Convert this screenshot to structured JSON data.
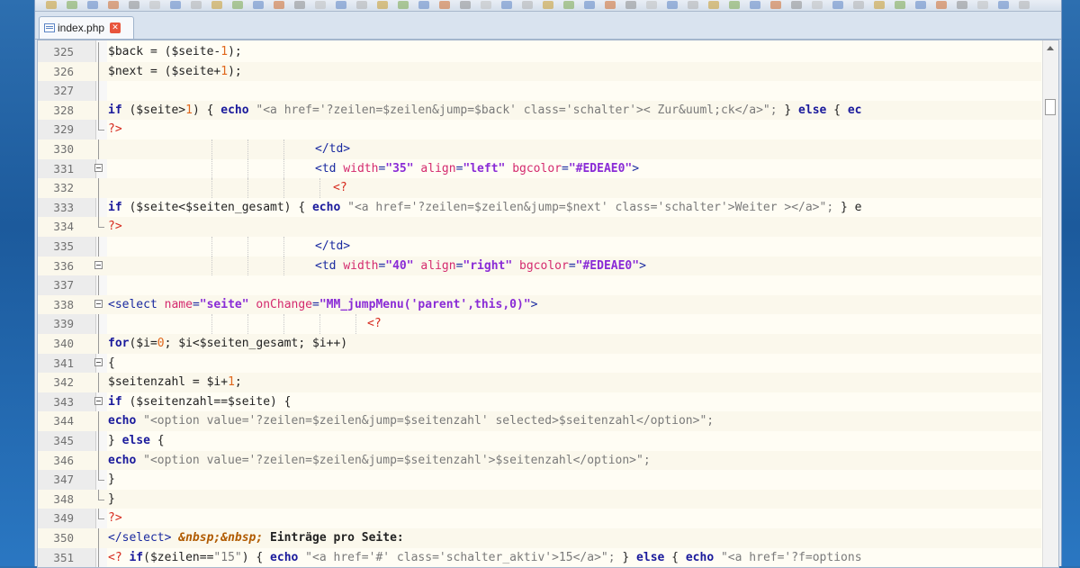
{
  "tab": {
    "label": "index.php",
    "close_glyph": "✕"
  },
  "editor": {
    "lines": [
      {
        "n": "325",
        "fold": "line",
        "segs": [
          [
            "v",
            "$back = ($seite-"
          ],
          [
            "n",
            "1"
          ],
          [
            "v",
            ");"
          ]
        ]
      },
      {
        "n": "326",
        "fold": "line",
        "segs": [
          [
            "v",
            "$next = ($seite+"
          ],
          [
            "n",
            "1"
          ],
          [
            "v",
            ");"
          ]
        ]
      },
      {
        "n": "327",
        "fold": "line",
        "segs": []
      },
      {
        "n": "328",
        "fold": "line",
        "segs": [
          [
            "k",
            "if"
          ],
          [
            "v",
            " ($seite>"
          ],
          [
            "n",
            "1"
          ],
          [
            "v",
            ") { "
          ],
          [
            "k",
            "echo"
          ],
          [
            "s",
            " \"<a href='?zeilen=$zeilen&jump=$back' class='schalter'>< Zur&uuml;ck</a>\";"
          ],
          [
            "v",
            " } "
          ],
          [
            "k",
            "else"
          ],
          [
            "v",
            " { "
          ],
          [
            "k",
            "ec"
          ]
        ]
      },
      {
        "n": "329",
        "fold": "end",
        "segs": [
          [
            "p",
            "?>"
          ]
        ]
      },
      {
        "n": "330",
        "fold": "line",
        "indent": 230,
        "segs": [
          [
            "t",
            "</td>"
          ]
        ]
      },
      {
        "n": "331",
        "fold": "box",
        "indent": 230,
        "segs": [
          [
            "t",
            "<td "
          ],
          [
            "a",
            "width"
          ],
          [
            "t",
            "="
          ],
          [
            "q",
            "\"35\""
          ],
          [
            "t",
            " "
          ],
          [
            "a",
            "align"
          ],
          [
            "t",
            "="
          ],
          [
            "q",
            "\"left\""
          ],
          [
            "t",
            " "
          ],
          [
            "a",
            "bgcolor"
          ],
          [
            "t",
            "="
          ],
          [
            "q",
            "\"#EDEAE0\""
          ],
          [
            "t",
            ">"
          ]
        ]
      },
      {
        "n": "332",
        "fold": "line",
        "indent": 250,
        "segs": [
          [
            "p",
            "<?"
          ]
        ]
      },
      {
        "n": "333",
        "fold": "line",
        "segs": [
          [
            "k",
            "if"
          ],
          [
            "v",
            " ($seite<$seiten_gesamt) { "
          ],
          [
            "k",
            "echo"
          ],
          [
            "s",
            " \"<a href='?zeilen=$zeilen&jump=$next' class='schalter'>Weiter ></a>\";"
          ],
          [
            "v",
            " } e"
          ]
        ]
      },
      {
        "n": "334",
        "fold": "end",
        "segs": [
          [
            "p",
            "?>"
          ]
        ]
      },
      {
        "n": "335",
        "fold": "line",
        "indent": 230,
        "segs": [
          [
            "t",
            "</td>"
          ]
        ]
      },
      {
        "n": "336",
        "fold": "box",
        "indent": 230,
        "segs": [
          [
            "t",
            "<td "
          ],
          [
            "a",
            "width"
          ],
          [
            "t",
            "="
          ],
          [
            "q",
            "\"40\""
          ],
          [
            "t",
            " "
          ],
          [
            "a",
            "align"
          ],
          [
            "t",
            "="
          ],
          [
            "q",
            "\"right\""
          ],
          [
            "t",
            " "
          ],
          [
            "a",
            "bgcolor"
          ],
          [
            "t",
            "="
          ],
          [
            "q",
            "\"#EDEAE0\""
          ],
          [
            "t",
            ">"
          ]
        ]
      },
      {
        "n": "337",
        "fold": "line",
        "segs": []
      },
      {
        "n": "338",
        "fold": "box",
        "segs": [
          [
            "t",
            "<select "
          ],
          [
            "a",
            "name"
          ],
          [
            "t",
            "="
          ],
          [
            "q",
            "\"seite\""
          ],
          [
            "t",
            " "
          ],
          [
            "a",
            "onChange"
          ],
          [
            "t",
            "="
          ],
          [
            "q",
            "\"MM_jumpMenu('parent',this,0)\""
          ],
          [
            "t",
            ">"
          ]
        ]
      },
      {
        "n": "339",
        "fold": "line",
        "indent": 288,
        "segs": [
          [
            "p",
            "<?"
          ]
        ]
      },
      {
        "n": "340",
        "fold": "line",
        "segs": [
          [
            "k",
            "for"
          ],
          [
            "v",
            "($i="
          ],
          [
            "n",
            "0"
          ],
          [
            "v",
            "; $i<$seiten_gesamt; $i++)"
          ]
        ]
      },
      {
        "n": "341",
        "fold": "box",
        "segs": [
          [
            "v",
            "{"
          ]
        ]
      },
      {
        "n": "342",
        "fold": "line",
        "segs": [
          [
            "v",
            "$seitenzahl = $i+"
          ],
          [
            "n",
            "1"
          ],
          [
            "v",
            ";"
          ]
        ]
      },
      {
        "n": "343",
        "fold": "box",
        "segs": [
          [
            "k",
            "if"
          ],
          [
            "v",
            " ($seitenzahl==$seite) {"
          ]
        ]
      },
      {
        "n": "344",
        "fold": "line",
        "segs": [
          [
            "k",
            "echo"
          ],
          [
            "s",
            " \"<option value='?zeilen=$zeilen&jump=$seitenzahl' selected>$seitenzahl</option>\";"
          ]
        ]
      },
      {
        "n": "345",
        "fold": "line",
        "segs": [
          [
            "v",
            "} "
          ],
          [
            "k",
            "else"
          ],
          [
            "v",
            " {"
          ]
        ]
      },
      {
        "n": "346",
        "fold": "line",
        "segs": [
          [
            "k",
            "echo"
          ],
          [
            "s",
            " \"<option value='?zeilen=$zeilen&jump=$seitenzahl'>$seitenzahl</option>\";"
          ]
        ]
      },
      {
        "n": "347",
        "fold": "end",
        "segs": [
          [
            "v",
            "}"
          ]
        ]
      },
      {
        "n": "348",
        "fold": "end",
        "segs": [
          [
            "v",
            "}"
          ]
        ]
      },
      {
        "n": "349",
        "fold": "end",
        "segs": [
          [
            "p",
            "?>"
          ]
        ]
      },
      {
        "n": "350",
        "fold": "line",
        "segs": [
          [
            "t",
            "</select> "
          ],
          [
            "e",
            "&nbsp;&nbsp;"
          ],
          [
            "b",
            " Einträge pro Seite:"
          ]
        ]
      },
      {
        "n": "351",
        "fold": "line",
        "segs": [
          [
            "p",
            "<?"
          ],
          [
            "v",
            " "
          ],
          [
            "k",
            "if"
          ],
          [
            "v",
            "($zeilen=="
          ],
          [
            "s",
            "\"15\""
          ],
          [
            "v",
            ") { "
          ],
          [
            "k",
            "echo"
          ],
          [
            "s",
            " \"<a href='#' class='schalter_aktiv'>15</a>\";"
          ],
          [
            "v",
            " } "
          ],
          [
            "k",
            "else"
          ],
          [
            "v",
            " { "
          ],
          [
            "k",
            "echo"
          ],
          [
            "s",
            " \"<a href='?f=options"
          ]
        ]
      }
    ]
  },
  "colors": {
    "background": "#fffdf4",
    "keyword": "#1a1a9c",
    "string": "#7a7a7a",
    "php_tag": "#d62a1e",
    "number": "#e0671c",
    "attribute": "#d42a6e",
    "attribute_value": "#8a2bd6"
  },
  "icons": [
    "file-icon",
    "close-icon",
    "fold-toggle-icon",
    "scroll-up-arrow-icon"
  ]
}
